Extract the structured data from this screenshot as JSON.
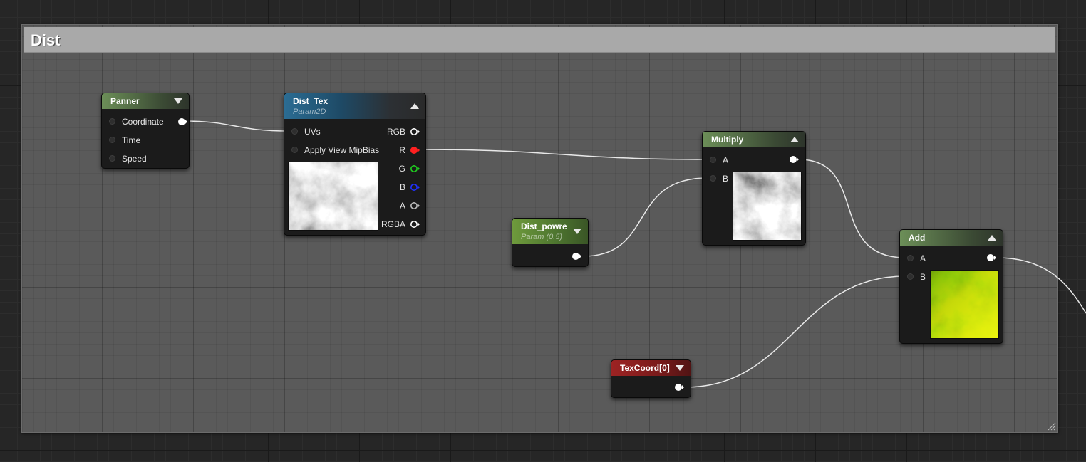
{
  "comment": {
    "title": "Dist"
  },
  "nodes": {
    "panner": {
      "title": "Panner",
      "inputs": [
        "Coordinate",
        "Time",
        "Speed"
      ]
    },
    "dist_tex": {
      "title": "Dist_Tex",
      "subtitle": "Param2D",
      "inputs": [
        "UVs",
        "Apply View MipBias"
      ],
      "outputs": [
        "RGB",
        "R",
        "G",
        "B",
        "A",
        "RGBA"
      ]
    },
    "multiply": {
      "title": "Multiply",
      "inputs": [
        "A",
        "B"
      ]
    },
    "dist_powre": {
      "title": "Dist_powre",
      "subtitle": "Param (0.5)"
    },
    "add": {
      "title": "Add",
      "inputs": [
        "A",
        "B"
      ]
    },
    "texcoord": {
      "title": "TexCoord[0]"
    }
  },
  "colors": {
    "panner_header": "#6c8f58",
    "texture_header": "#2b6c93",
    "scalar_param_header": "#6e9a3c",
    "texcoord_header": "#9c2323",
    "pin_r": "#ff2020",
    "pin_g": "#20d020",
    "pin_b": "#2030ff",
    "wire": "#e8e8e8"
  },
  "icons": [
    "collapse-arrow-icon",
    "expand-arrow-icon",
    "resize-grip-icon"
  ]
}
